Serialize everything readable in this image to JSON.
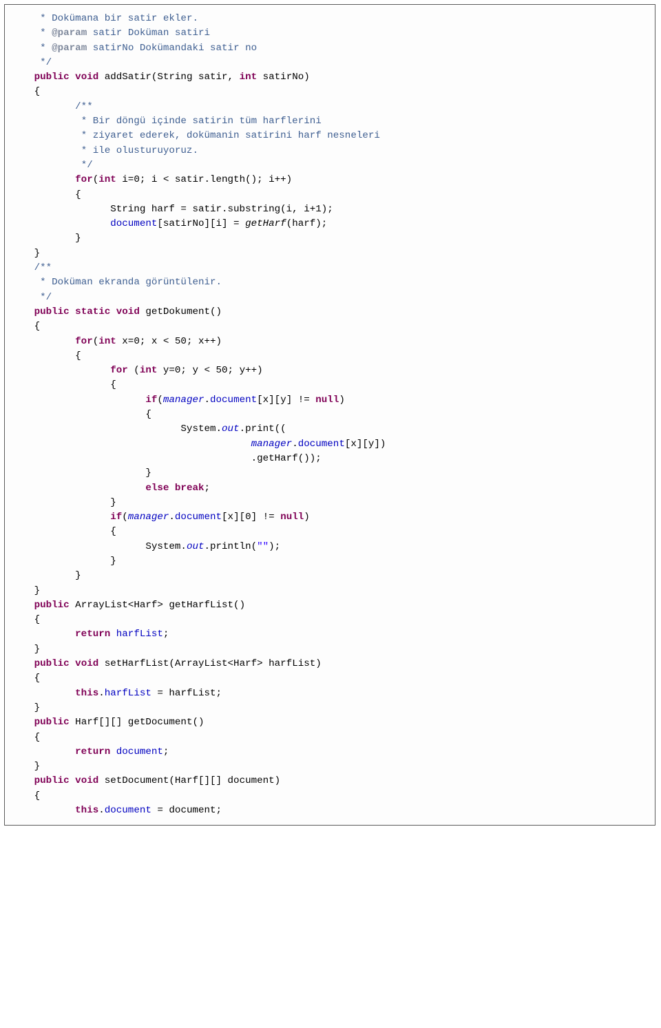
{
  "lines": [
    {
      "indent": "      ",
      "parts": [
        {
          "c": "comment",
          "t": "* Dokümana bir satir ekler."
        }
      ]
    },
    {
      "indent": "      ",
      "parts": [
        {
          "c": "comment",
          "t": "* "
        },
        {
          "c": "doctag",
          "t": "@param"
        },
        {
          "c": "comment",
          "t": " satir Doküman satiri"
        }
      ]
    },
    {
      "indent": "      ",
      "parts": [
        {
          "c": "comment",
          "t": "* "
        },
        {
          "c": "doctag",
          "t": "@param"
        },
        {
          "c": "comment",
          "t": " satirNo Dokümandaki satir no"
        }
      ]
    },
    {
      "indent": "      ",
      "parts": [
        {
          "c": "comment",
          "t": "*/"
        }
      ]
    },
    {
      "indent": "     ",
      "parts": [
        {
          "c": "kw",
          "t": "public void"
        },
        {
          "c": "plain",
          "t": " addSatir(String satir, "
        },
        {
          "c": "kw",
          "t": "int"
        },
        {
          "c": "plain",
          "t": " satirNo)"
        }
      ]
    },
    {
      "indent": "     ",
      "parts": [
        {
          "c": "plain",
          "t": "{"
        }
      ]
    },
    {
      "indent": "            ",
      "parts": [
        {
          "c": "comment",
          "t": "/**"
        }
      ]
    },
    {
      "indent": "             ",
      "parts": [
        {
          "c": "comment",
          "t": "* Bir döngü içinde satirin tüm harflerini"
        }
      ]
    },
    {
      "indent": "             ",
      "parts": [
        {
          "c": "comment",
          "t": "* ziyaret ederek, dokümanin satirini harf nesneleri"
        }
      ]
    },
    {
      "indent": "             ",
      "parts": [
        {
          "c": "comment",
          "t": "* ile olusturuyoruz."
        }
      ]
    },
    {
      "indent": "             ",
      "parts": [
        {
          "c": "comment",
          "t": "*/"
        }
      ]
    },
    {
      "indent": "            ",
      "parts": [
        {
          "c": "kw",
          "t": "for"
        },
        {
          "c": "plain",
          "t": "("
        },
        {
          "c": "kw",
          "t": "int"
        },
        {
          "c": "plain",
          "t": " i=0; i < satir.length(); i++)"
        }
      ]
    },
    {
      "indent": "            ",
      "parts": [
        {
          "c": "plain",
          "t": "{"
        }
      ]
    },
    {
      "indent": "                  ",
      "parts": [
        {
          "c": "plain",
          "t": "String harf = satir.substring(i, i+1);"
        }
      ]
    },
    {
      "indent": "                  ",
      "parts": [
        {
          "c": "field",
          "t": "document"
        },
        {
          "c": "plain",
          "t": "[satirNo][i] = "
        },
        {
          "c": "staticcall",
          "t": "getHarf"
        },
        {
          "c": "plain",
          "t": "(harf);"
        }
      ]
    },
    {
      "indent": "            ",
      "parts": [
        {
          "c": "plain",
          "t": "}"
        }
      ]
    },
    {
      "indent": "     ",
      "parts": [
        {
          "c": "plain",
          "t": "}"
        }
      ]
    },
    {
      "indent": "",
      "parts": [
        {
          "c": "plain",
          "t": ""
        }
      ]
    },
    {
      "indent": "",
      "parts": [
        {
          "c": "plain",
          "t": ""
        }
      ]
    },
    {
      "indent": "     ",
      "parts": [
        {
          "c": "comment",
          "t": "/**"
        }
      ]
    },
    {
      "indent": "      ",
      "parts": [
        {
          "c": "comment",
          "t": "* Doküman ekranda görüntülenir."
        }
      ]
    },
    {
      "indent": "      ",
      "parts": [
        {
          "c": "comment",
          "t": "*/"
        }
      ]
    },
    {
      "indent": "     ",
      "parts": [
        {
          "c": "kw",
          "t": "public static void"
        },
        {
          "c": "plain",
          "t": " getDokument()"
        }
      ]
    },
    {
      "indent": "     ",
      "parts": [
        {
          "c": "plain",
          "t": "{"
        }
      ]
    },
    {
      "indent": "            ",
      "parts": [
        {
          "c": "kw",
          "t": "for"
        },
        {
          "c": "plain",
          "t": "("
        },
        {
          "c": "kw",
          "t": "int"
        },
        {
          "c": "plain",
          "t": " x=0; x < 50; x++)"
        }
      ]
    },
    {
      "indent": "            ",
      "parts": [
        {
          "c": "plain",
          "t": "{"
        }
      ]
    },
    {
      "indent": "                  ",
      "parts": [
        {
          "c": "kw",
          "t": "for"
        },
        {
          "c": "plain",
          "t": " ("
        },
        {
          "c": "kw",
          "t": "int"
        },
        {
          "c": "plain",
          "t": " y=0; y < 50; y++)"
        }
      ]
    },
    {
      "indent": "                  ",
      "parts": [
        {
          "c": "plain",
          "t": "{"
        }
      ]
    },
    {
      "indent": "                        ",
      "parts": [
        {
          "c": "kw",
          "t": "if"
        },
        {
          "c": "plain",
          "t": "("
        },
        {
          "c": "staticf",
          "t": "manager"
        },
        {
          "c": "plain",
          "t": "."
        },
        {
          "c": "field",
          "t": "document"
        },
        {
          "c": "plain",
          "t": "[x][y] != "
        },
        {
          "c": "kw",
          "t": "null"
        },
        {
          "c": "plain",
          "t": ")"
        }
      ]
    },
    {
      "indent": "                        ",
      "parts": [
        {
          "c": "plain",
          "t": "{"
        }
      ]
    },
    {
      "indent": "                              ",
      "parts": [
        {
          "c": "plain",
          "t": "System."
        },
        {
          "c": "staticf",
          "t": "out"
        },
        {
          "c": "plain",
          "t": ".print(("
        }
      ]
    },
    {
      "indent": "                                          ",
      "parts": [
        {
          "c": "staticf",
          "t": "manager"
        },
        {
          "c": "plain",
          "t": "."
        },
        {
          "c": "field",
          "t": "document"
        },
        {
          "c": "plain",
          "t": "[x][y])"
        }
      ]
    },
    {
      "indent": "                                          ",
      "parts": [
        {
          "c": "plain",
          "t": ".getHarf());"
        }
      ]
    },
    {
      "indent": "                        ",
      "parts": [
        {
          "c": "plain",
          "t": "}"
        }
      ]
    },
    {
      "indent": "                        ",
      "parts": [
        {
          "c": "kw",
          "t": "else break"
        },
        {
          "c": "plain",
          "t": ";"
        }
      ]
    },
    {
      "indent": "                  ",
      "parts": [
        {
          "c": "plain",
          "t": "}"
        }
      ]
    },
    {
      "indent": "                  ",
      "parts": [
        {
          "c": "kw",
          "t": "if"
        },
        {
          "c": "plain",
          "t": "("
        },
        {
          "c": "staticf",
          "t": "manager"
        },
        {
          "c": "plain",
          "t": "."
        },
        {
          "c": "field",
          "t": "document"
        },
        {
          "c": "plain",
          "t": "[x][0] != "
        },
        {
          "c": "kw",
          "t": "null"
        },
        {
          "c": "plain",
          "t": ")"
        }
      ]
    },
    {
      "indent": "                  ",
      "parts": [
        {
          "c": "plain",
          "t": "{"
        }
      ]
    },
    {
      "indent": "                        ",
      "parts": [
        {
          "c": "plain",
          "t": "System."
        },
        {
          "c": "staticf",
          "t": "out"
        },
        {
          "c": "plain",
          "t": ".println("
        },
        {
          "c": "string",
          "t": "\"\""
        },
        {
          "c": "plain",
          "t": ");"
        }
      ]
    },
    {
      "indent": "                  ",
      "parts": [
        {
          "c": "plain",
          "t": "}"
        }
      ]
    },
    {
      "indent": "            ",
      "parts": [
        {
          "c": "plain",
          "t": "}"
        }
      ]
    },
    {
      "indent": "     ",
      "parts": [
        {
          "c": "plain",
          "t": "}"
        }
      ]
    },
    {
      "indent": "",
      "parts": [
        {
          "c": "plain",
          "t": ""
        }
      ]
    },
    {
      "indent": "",
      "parts": [
        {
          "c": "plain",
          "t": ""
        }
      ]
    },
    {
      "indent": "     ",
      "parts": [
        {
          "c": "kw",
          "t": "public"
        },
        {
          "c": "plain",
          "t": " ArrayList<Harf> getHarfList()"
        }
      ]
    },
    {
      "indent": "     ",
      "parts": [
        {
          "c": "plain",
          "t": "{"
        }
      ]
    },
    {
      "indent": "            ",
      "parts": [
        {
          "c": "kw",
          "t": "return"
        },
        {
          "c": "plain",
          "t": " "
        },
        {
          "c": "field",
          "t": "harfList"
        },
        {
          "c": "plain",
          "t": ";"
        }
      ]
    },
    {
      "indent": "     ",
      "parts": [
        {
          "c": "plain",
          "t": "}"
        }
      ]
    },
    {
      "indent": "",
      "parts": [
        {
          "c": "plain",
          "t": ""
        }
      ]
    },
    {
      "indent": "     ",
      "parts": [
        {
          "c": "kw",
          "t": "public void"
        },
        {
          "c": "plain",
          "t": " setHarfList(ArrayList<Harf> harfList)"
        }
      ]
    },
    {
      "indent": "     ",
      "parts": [
        {
          "c": "plain",
          "t": "{"
        }
      ]
    },
    {
      "indent": "            ",
      "parts": [
        {
          "c": "kw",
          "t": "this"
        },
        {
          "c": "plain",
          "t": "."
        },
        {
          "c": "field",
          "t": "harfList"
        },
        {
          "c": "plain",
          "t": " = harfList;"
        }
      ]
    },
    {
      "indent": "     ",
      "parts": [
        {
          "c": "plain",
          "t": "}"
        }
      ]
    },
    {
      "indent": "",
      "parts": [
        {
          "c": "plain",
          "t": ""
        }
      ]
    },
    {
      "indent": "     ",
      "parts": [
        {
          "c": "kw",
          "t": "public"
        },
        {
          "c": "plain",
          "t": " Harf[][] getDocument()"
        }
      ]
    },
    {
      "indent": "     ",
      "parts": [
        {
          "c": "plain",
          "t": "{"
        }
      ]
    },
    {
      "indent": "            ",
      "parts": [
        {
          "c": "kw",
          "t": "return"
        },
        {
          "c": "plain",
          "t": " "
        },
        {
          "c": "field",
          "t": "document"
        },
        {
          "c": "plain",
          "t": ";"
        }
      ]
    },
    {
      "indent": "     ",
      "parts": [
        {
          "c": "plain",
          "t": "}"
        }
      ]
    },
    {
      "indent": "",
      "parts": [
        {
          "c": "plain",
          "t": ""
        }
      ]
    },
    {
      "indent": "     ",
      "parts": [
        {
          "c": "kw",
          "t": "public void"
        },
        {
          "c": "plain",
          "t": " setDocument(Harf[][] document)"
        }
      ]
    },
    {
      "indent": "     ",
      "parts": [
        {
          "c": "plain",
          "t": "{"
        }
      ]
    },
    {
      "indent": "            ",
      "parts": [
        {
          "c": "kw",
          "t": "this"
        },
        {
          "c": "plain",
          "t": "."
        },
        {
          "c": "field",
          "t": "document"
        },
        {
          "c": "plain",
          "t": " = document;"
        }
      ]
    }
  ]
}
